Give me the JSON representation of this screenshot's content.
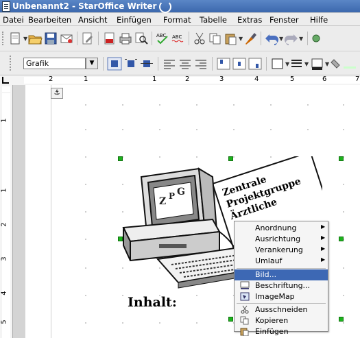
{
  "window": {
    "title": "Unbenannt2 - StarOffice Writer"
  },
  "menu": [
    "Datei",
    "Bearbeiten",
    "Ansicht",
    "Einfügen",
    "Format",
    "Tabelle",
    "Extras",
    "Fenster",
    "Hilfe"
  ],
  "toolbar": {
    "style_value": "Grafik"
  },
  "ruler": {
    "h_numbers": [
      "2",
      "1",
      "1",
      "2",
      "3",
      "4",
      "5",
      "6",
      "7"
    ],
    "v_numbers": [
      "1",
      "1",
      "2",
      "3",
      "4",
      "5"
    ]
  },
  "document": {
    "heading": "Inhalt:",
    "image_text": [
      "Zentrale",
      "Projektgruppe",
      "Ärztliche"
    ]
  },
  "context_menu": {
    "items": [
      {
        "label": "Anordnung",
        "submenu": true
      },
      {
        "label": "Ausrichtung",
        "submenu": true
      },
      {
        "label": "Verankerung",
        "submenu": true
      },
      {
        "label": "Umlauf",
        "submenu": true
      },
      {
        "label": "Bild...",
        "highlighted": true
      },
      {
        "label": "Beschriftung..."
      },
      {
        "label": "ImageMap"
      },
      {
        "label": "Ausschneiden"
      },
      {
        "label": "Kopieren"
      },
      {
        "label": "Einfügen"
      }
    ]
  },
  "colors": {
    "title_bar": "#3c68ad",
    "highlight": "#3d68b4",
    "handle": "#1db31d"
  }
}
